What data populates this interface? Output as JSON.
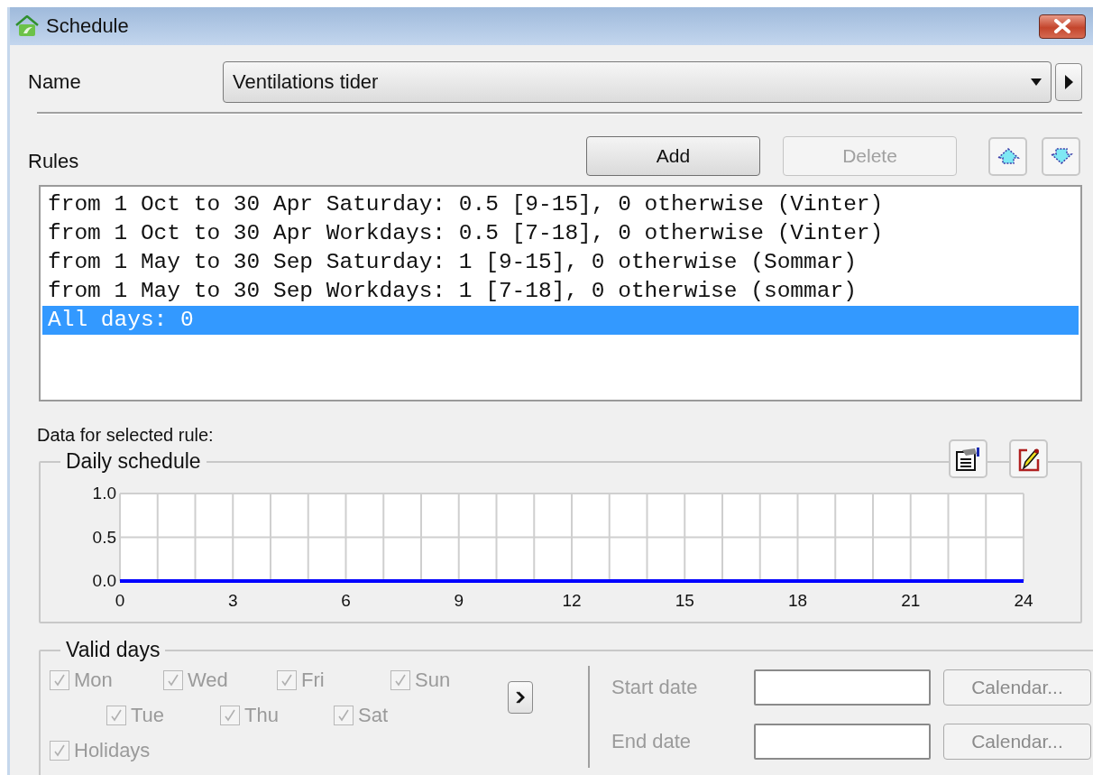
{
  "window": {
    "title": "Schedule"
  },
  "name": {
    "label": "Name",
    "value": "Ventilations tider"
  },
  "rules": {
    "label": "Rules",
    "add": {
      "label": "Add",
      "disabled": false
    },
    "delete": {
      "label": "Delete",
      "disabled": true
    },
    "items": [
      {
        "text": "from 1 Oct to 30 Apr Saturday: 0.5 [9-15], 0 otherwise (Vinter)",
        "selected": false
      },
      {
        "text": "from 1 Oct to 30 Apr Workdays: 0.5 [7-18], 0 otherwise (Vinter)",
        "selected": false
      },
      {
        "text": "from 1 May to 30 Sep Saturday: 1 [9-15], 0 otherwise (Sommar)",
        "selected": false
      },
      {
        "text": "from 1 May to 30 Sep Workdays: 1 [7-18], 0 otherwise (sommar)",
        "selected": false
      },
      {
        "text": "All days: 0",
        "selected": true
      }
    ]
  },
  "data_label": "Data for selected rule:",
  "daily_schedule": {
    "title": "Daily schedule",
    "chart_data": {
      "type": "line",
      "x": [
        0,
        24
      ],
      "grid": true,
      "series": [
        {
          "color": "#0000ff",
          "values": [
            0,
            0
          ]
        }
      ],
      "xlim": [
        0,
        24
      ],
      "ylim": [
        0,
        1
      ],
      "xticks": [
        0,
        3,
        6,
        9,
        12,
        15,
        18,
        21,
        24
      ],
      "yticks": [
        {
          "value": 0,
          "label": "0.0"
        },
        {
          "value": 0.5,
          "label": "0.5"
        },
        {
          "value": 1,
          "label": "1.0"
        }
      ]
    }
  },
  "valid_days": {
    "title": "Valid days",
    "days": [
      {
        "label": "Mon",
        "checked": true,
        "disabled": true
      },
      {
        "label": "Tue",
        "checked": true,
        "disabled": true
      },
      {
        "label": "Wed",
        "checked": true,
        "disabled": true
      },
      {
        "label": "Thu",
        "checked": true,
        "disabled": true
      },
      {
        "label": "Fri",
        "checked": true,
        "disabled": true
      },
      {
        "label": "Sat",
        "checked": true,
        "disabled": true
      },
      {
        "label": "Sun",
        "checked": true,
        "disabled": true
      }
    ],
    "holidays": {
      "label": "Holidays",
      "checked": true,
      "disabled": true
    },
    "start_date": {
      "label": "Start date",
      "disabled": true,
      "button": "Calendar..."
    },
    "end_date": {
      "label": "End date",
      "disabled": true,
      "button": "Calendar..."
    }
  }
}
